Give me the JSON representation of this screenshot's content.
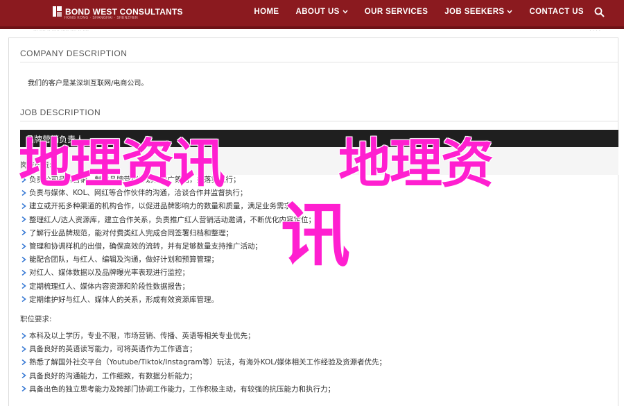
{
  "header": {
    "logo_text": "BOND WEST CONSULTANTS",
    "logo_sub": "HONG KONG · SHANGHAI · SHENZHEN",
    "nav": [
      {
        "label": "HOME",
        "dropdown": false
      },
      {
        "label": "ABOUT US",
        "dropdown": true
      },
      {
        "label": "OUR SERVICES",
        "dropdown": false
      },
      {
        "label": "JOB SEEKERS",
        "dropdown": true
      },
      {
        "label": "CONTACT US",
        "dropdown": false
      }
    ],
    "search_icon": "search-icon",
    "colors": {
      "brand": "#8b1a1f",
      "watermark": "#ff1fd0"
    }
  },
  "info_strip": {
    "left": "··· ···· ·· ·····  ·····  ···· ·· ····",
    "right": "· · · ·"
  },
  "company": {
    "title": "COMPANY DESCRIPTION",
    "text": "我们的客户是某深圳互联网/电商公司。"
  },
  "job": {
    "title": "JOB DESCRIPTION",
    "position": "品牌营销负责人",
    "duties_heading": "岗位职责:",
    "duties": [
      "负责公司品牌营销，制定品牌营销计划和推广策略，并落实执行；",
      "负责与媒体、KOL、网红等合作伙伴的沟通，洽谈合作并监督执行；",
      "建立或开拓多种渠道的机构合作，以促进品牌影响力的数量和质量，满足业务需求；",
      "整理红人/达人资源库，建立合作关系，负责推广红人营销活动邀请，不断优化内容定位；",
      "了解行业品牌规范，能对付费类红人完成合同签署归档和整理；",
      "管理和协调样机的出借，确保高效的流转，并有足够数量支持推广活动；",
      "能配合团队，与红人、编辑及沟通，做好计划和预算管理；",
      "对红人、媒体数据以及品牌曝光率表现进行监控；",
      "定期梳理红人、媒体内容资源和阶段性数据报告；",
      "定期维护好与红人、媒体人的关系，形成有效资源库管理。"
    ],
    "req_heading": "职位要求:",
    "requirements": [
      "本科及以上学历，专业不限，市场营销、传播、英语等相关专业优先；",
      "具备良好的英语读写能力，可将英语作为工作语言；",
      "熟悉了解国外社交平台（Youtube/Tiktok/Instagram等）玩法，有海外KOL/媒体相关工作经验及资源者优先；",
      "具备良好的沟通能力，工作细致，有数据分析能力；",
      "具备出色的独立思考能力及跨部门协调工作能力，工作积极主动，有较强的抗压能力和执行力；"
    ]
  },
  "watermark": {
    "line1": "地理资讯",
    "line2": "地理资",
    "line3": "讯"
  }
}
